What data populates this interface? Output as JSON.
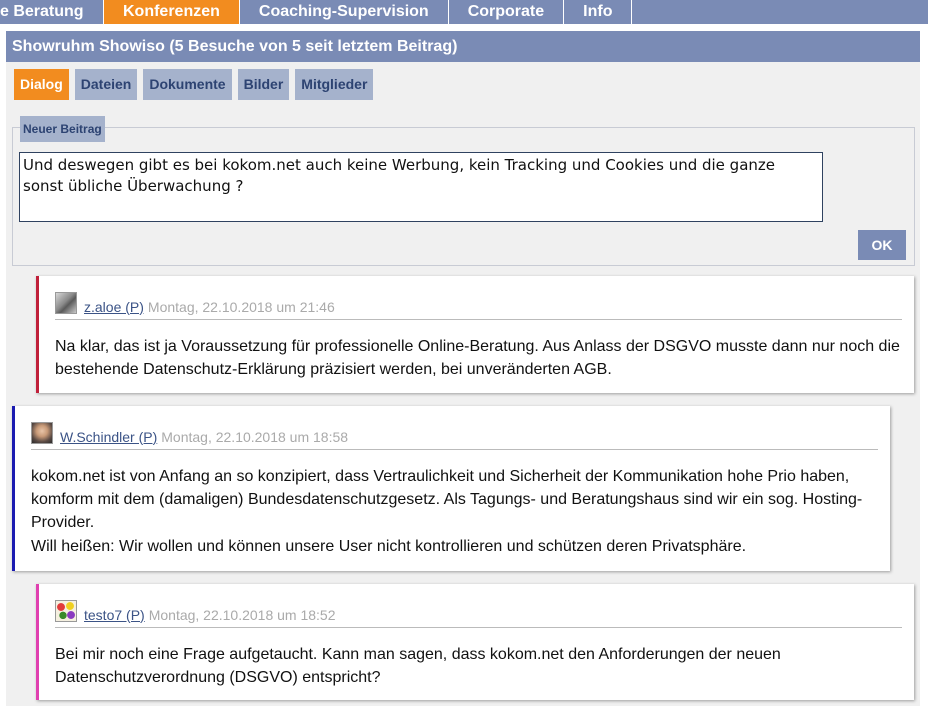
{
  "nav": {
    "items": [
      {
        "label": "e Beratung",
        "active": false
      },
      {
        "label": "Konferenzen",
        "active": true
      },
      {
        "label": "Coaching-Supervision",
        "active": false
      },
      {
        "label": "Corporate",
        "active": false
      },
      {
        "label": "Info",
        "active": false
      }
    ]
  },
  "room": {
    "title": "Showruhm Showiso (5 Besuche von 5 seit letztem Beitrag)"
  },
  "tabs": [
    {
      "label": "Dialog",
      "active": true
    },
    {
      "label": "Dateien",
      "active": false
    },
    {
      "label": "Dokumente",
      "active": false
    },
    {
      "label": "Bilder",
      "active": false
    },
    {
      "label": "Mitglieder",
      "active": false
    }
  ],
  "composer": {
    "legend": "Neuer Beitrag",
    "text": "Und deswegen gibt es bei kokom.net auch keine Werbung, kein Tracking und Cookies und die ganze sonst übliche Überwachung ?",
    "ok_label": "OK"
  },
  "comments": [
    {
      "author": "z.aloe (P)",
      "date": "Montag, 22.10.2018 um 21:46",
      "text": "Na klar, das ist ja Voraussetzung für professionelle Online-Beratung. Aus Anlass der DSGVO musste dann nur noch die bestehende Datenschutz-Erklärung präzisiert werden, bei unveränderten AGB.",
      "accent": "#c0203a",
      "avatar": "grey-photo"
    },
    {
      "author": "W.Schindler (P)",
      "date": "Montag, 22.10.2018 um 18:58",
      "text": "kokom.net ist von Anfang an so konzipiert, dass Vertraulichkeit und Sicherheit der Kommunikation hohe Prio haben, komform mit dem (damaligen) Bundesdatenschutzgesetz. Als Tagungs- und Beratungshaus sind wir ein sog. Hosting-Provider.",
      "text2": "Will heißen: Wir wollen und können unsere User nicht kontrollieren und schützen deren Privatsphäre.",
      "accent": "#1a1ab0",
      "avatar": "portrait-photo"
    },
    {
      "author": "testo7 (P)",
      "date": "Montag, 22.10.2018 um 18:52",
      "text": "Bei mir noch eine Frage aufgetaucht. Kann man sagen, dass kokom.net den Anforderungen der neuen Datenschutzverordnung (DSGVO) entspricht?",
      "accent": "#e040b0",
      "avatar": "colorful-flowers"
    }
  ]
}
